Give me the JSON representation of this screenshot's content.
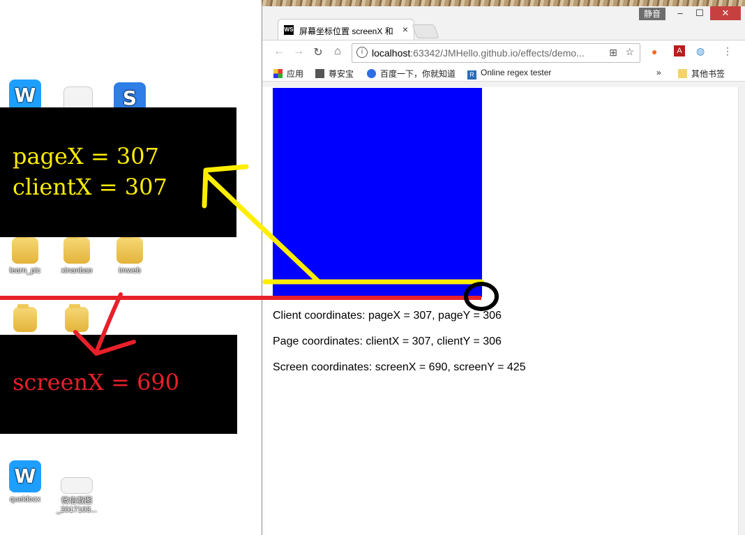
{
  "desktop": {
    "icons": [
      {
        "label": "",
        "type": "wps"
      },
      {
        "label": "",
        "type": "doc"
      },
      {
        "label": "",
        "type": "sogou"
      },
      {
        "label": "learn_pic",
        "type": "folder"
      },
      {
        "label": "xinanbao",
        "type": "folder"
      },
      {
        "label": "imweb",
        "type": "folder"
      },
      {
        "label": "",
        "type": "folder"
      },
      {
        "label": "",
        "type": "folder"
      },
      {
        "label": "queidocx",
        "type": "wps"
      },
      {
        "label": "微信截图_2017103...",
        "type": "doc"
      }
    ]
  },
  "annotations": {
    "page_x": "pageX = 307",
    "client_x": "clientX = 307",
    "screen_x": "screenX = 690",
    "colors": {
      "yellow": "#ffee00",
      "red": "#e8202a",
      "black": "#000000"
    }
  },
  "browser": {
    "tab_title": "屏幕坐标位置 screenX 和",
    "tab_favicon": "WS",
    "mute_label": "静音",
    "window_controls": {
      "minimize": "–",
      "maximize": "☐",
      "close": "✕"
    },
    "url_host": "localhost",
    "url_rest": ":63342/JMHello.github.io/effects/demo...",
    "bookmarks": [
      {
        "label": "应用",
        "icon": "apps-icon"
      },
      {
        "label": "尊安宝",
        "icon": "bookmark-icon"
      },
      {
        "label": "百度一下，你就知道",
        "icon": "baidu-icon"
      },
      {
        "label": "Online regex tester",
        "icon": "regex-icon"
      }
    ],
    "more_bookmarks": "»",
    "other_bookmarks": "其他书签"
  },
  "page": {
    "box_color": "#0000ff",
    "client_line": "Client coordinates: pageX = 307, pageY = 306",
    "page_line": "Page coordinates: clientX = 307, clientY = 306",
    "screen_line": "Screen coordinates: screenX = 690, screenY = 425"
  }
}
